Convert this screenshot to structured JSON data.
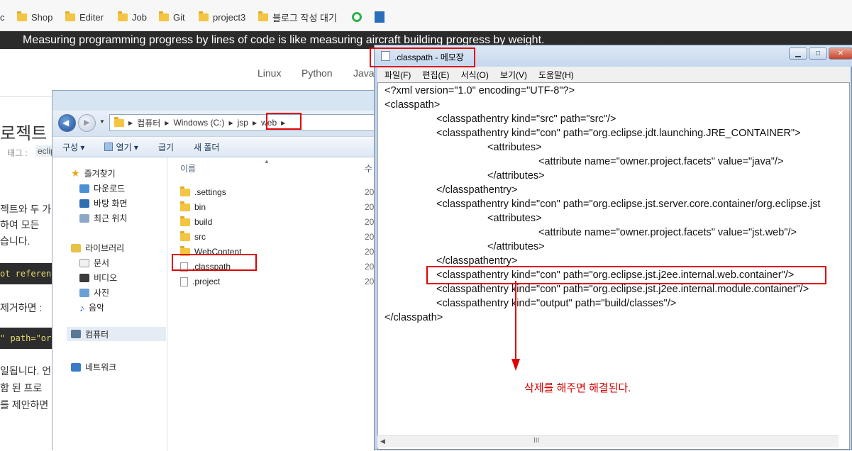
{
  "browser": {
    "bookmarks": [
      {
        "label": "c",
        "type": "partial"
      },
      {
        "label": "Shop",
        "type": "folder"
      },
      {
        "label": "Editer",
        "type": "folder"
      },
      {
        "label": "Job",
        "type": "folder"
      },
      {
        "label": "Git",
        "type": "folder"
      },
      {
        "label": "project3",
        "type": "folder"
      },
      {
        "label": "블로그 작성 대기",
        "type": "folder"
      }
    ]
  },
  "blog": {
    "quote": "Measuring programming progress by lines of code is like measuring aircraft building progress by weight.",
    "nav": [
      "Linux",
      "Python",
      "Java"
    ],
    "title_fragment": "로젝트",
    "tag_label": "태그 :",
    "tag_value": "eclip",
    "para1": [
      "젝트와 두 가",
      "하여 모든",
      "습니다."
    ],
    "code1": "ot referenc",
    "remove_text": "제거하면 :",
    "code2": "\" path=\"org",
    "para2": [
      "일됩니다. 언",
      "함 된 프로",
      "를 제안하면"
    ]
  },
  "explorer": {
    "breadcrumb": [
      "컴퓨터",
      "Windows (C:)",
      "jsp",
      "web"
    ],
    "toolbar": [
      "구성 ▾",
      "열기 ▾",
      "굽기",
      "새 폴더"
    ],
    "column_name": "이름",
    "column_date": "수",
    "nav": {
      "favorites": "즐겨찾기",
      "downloads": "다운로드",
      "desktop": "바탕 화면",
      "recent": "최근 위치",
      "libraries": "라이브러리",
      "documents": "문서",
      "videos": "비디오",
      "pictures": "사진",
      "music": "음악",
      "computer": "컴퓨터",
      "network": "네트워크"
    },
    "files": [
      {
        "name": ".settings",
        "kind": "folder",
        "date": "20"
      },
      {
        "name": "bin",
        "kind": "folder",
        "date": "20"
      },
      {
        "name": "build",
        "kind": "folder",
        "date": "20"
      },
      {
        "name": "src",
        "kind": "folder",
        "date": "20"
      },
      {
        "name": "WebContent",
        "kind": "folder",
        "date": "20"
      },
      {
        "name": ".classpath",
        "kind": "file",
        "date": "20"
      },
      {
        "name": ".project",
        "kind": "file",
        "date": "20"
      }
    ]
  },
  "notepad": {
    "title": ".classpath - 메모장",
    "menu": [
      "파일(F)",
      "편집(E)",
      "서식(O)",
      "보기(V)",
      "도움말(H)"
    ],
    "lines": [
      "<?xml version=\"1.0\" encoding=\"UTF-8\"?>",
      "<classpath>",
      "<classpathentry kind=\"src\" path=\"src\"/>",
      "<classpathentry kind=\"con\" path=\"org.eclipse.jdt.launching.JRE_CONTAINER\">",
      "<attributes>",
      "<attribute name=\"owner.project.facets\" value=\"java\"/>",
      "</attributes>",
      "</classpathentry>",
      "<classpathentry kind=\"con\" path=\"org.eclipse.jst.server.core.container/org.eclipse.jst",
      "<attributes>",
      "<attribute name=\"owner.project.facets\" value=\"jst.web\"/>",
      "</attributes>",
      "</classpathentry>",
      "<classpathentry kind=\"con\" path=\"org.eclipse.jst.j2ee.internal.web.container\"/>",
      "<classpathentry kind=\"con\" path=\"org.eclipse.jst.j2ee.internal.module.container\"/>",
      "<classpathentry kind=\"output\" path=\"build/classes\"/>",
      "</classpath>"
    ],
    "hscroll_grip": "III"
  },
  "annotation": {
    "text": "삭제를 해주면 해결된다.",
    "color": "#d40000"
  }
}
